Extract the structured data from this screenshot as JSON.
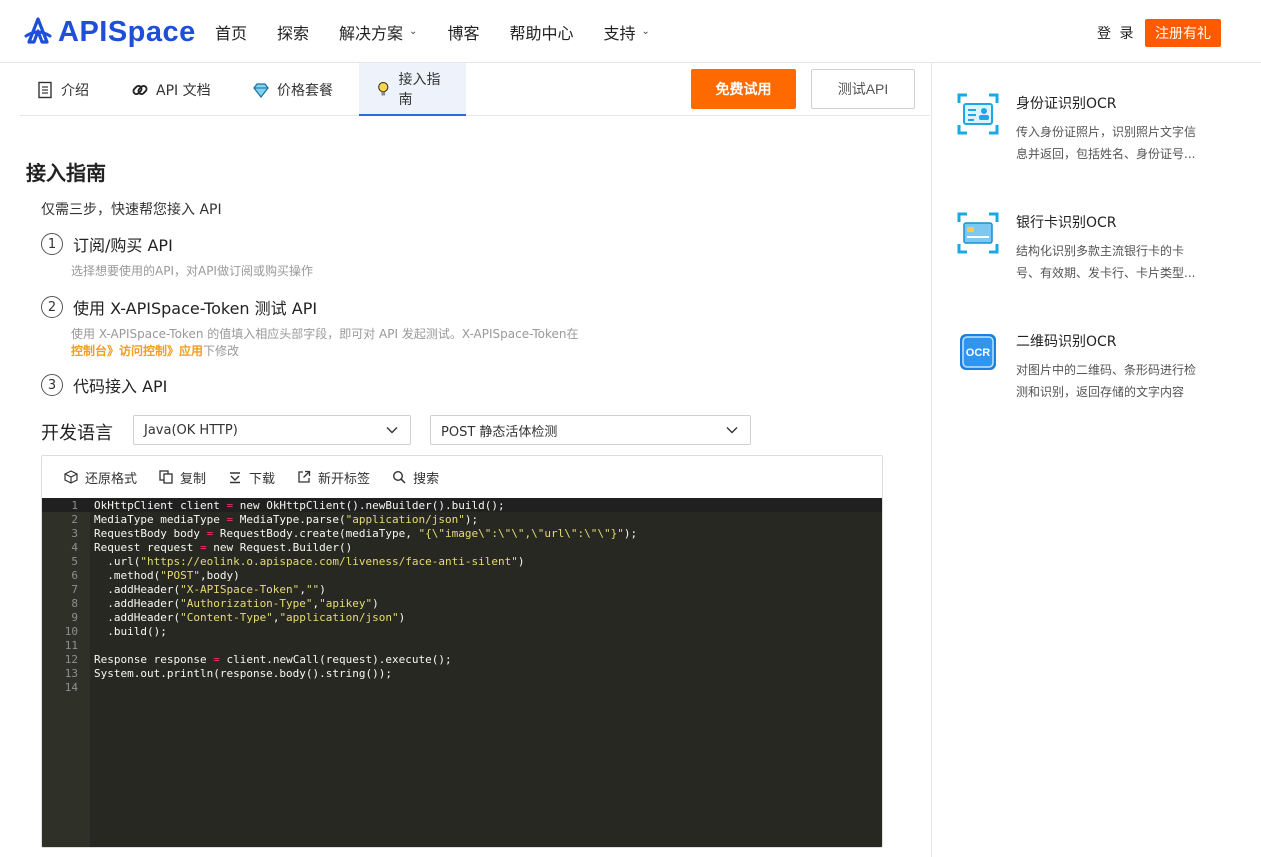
{
  "brand": {
    "name": "APISpace",
    "logo_color": "#1d4fd8"
  },
  "nav": {
    "items": [
      {
        "label": "首页",
        "dropdown": false
      },
      {
        "label": "探索",
        "dropdown": false
      },
      {
        "label": "解决方案",
        "dropdown": true
      },
      {
        "label": "博客",
        "dropdown": false
      },
      {
        "label": "帮助中心",
        "dropdown": false
      },
      {
        "label": "支持",
        "dropdown": true
      }
    ],
    "login_label": "登 录",
    "register_label": "注册有礼"
  },
  "tabs": [
    {
      "label": "介绍",
      "icon": "document-icon"
    },
    {
      "label": "API 文档",
      "icon": "link-icon"
    },
    {
      "label": "价格套餐",
      "icon": "diamond-icon"
    },
    {
      "label": "接入指南",
      "icon": "lightbulb-icon",
      "active": true
    }
  ],
  "actions": {
    "trial_label": "免费试用",
    "test_label": "测试API"
  },
  "guide": {
    "title": "接入指南",
    "intro": "仅需三步，快速帮您接入 API",
    "steps": [
      {
        "num": "1",
        "title": "订阅/购买 API",
        "desc": "选择想要使用的API，对API做订阅或购买操作"
      },
      {
        "num": "2",
        "title": "使用 X-APISpace-Token 测试 API",
        "desc": "使用 X-APISpace-Token 的值填入相应头部字段，即可对 API 发起测试。X-APISpace-Token在",
        "desc_link": "控制台》访问控制》应用",
        "desc_tail": "下修改"
      },
      {
        "num": "3",
        "title": "代码接入 API"
      }
    ]
  },
  "dev": {
    "label": "开发语言",
    "language_selected": "Java(OK HTTP)",
    "endpoint_selected": "POST 静态活体检测"
  },
  "code_toolbar": [
    {
      "label": "还原格式",
      "icon": "cube-icon"
    },
    {
      "label": "复制",
      "icon": "copy-icon"
    },
    {
      "label": "下载",
      "icon": "download-icon"
    },
    {
      "label": "新开标签",
      "icon": "external-link-icon"
    },
    {
      "label": "搜索",
      "icon": "search-icon"
    }
  ],
  "code_lines": [
    "OkHttpClient client = new OkHttpClient().newBuilder().build();",
    "MediaType mediaType = MediaType.parse(\"application/json\");",
    "RequestBody body = RequestBody.create(mediaType, \"{\\\"image\\\":\\\"\\\",\\\"url\\\":\\\"\\\"}\");",
    "Request request = new Request.Builder()",
    "  .url(\"https://eolink.o.apispace.com/liveness/face-anti-silent\")",
    "  .method(\"POST\",body)",
    "  .addHeader(\"X-APISpace-Token\",\"\")",
    "  .addHeader(\"Authorization-Type\",\"apikey\")",
    "  .addHeader(\"Content-Type\",\"application/json\")",
    "  .build();",
    "",
    "Response response = client.newCall(request).execute();",
    "System.out.println(response.body().string());",
    ""
  ],
  "related": [
    {
      "name": "身份证识别OCR",
      "desc": "传入身份证照片，识别照片文字信息并返回，包括姓名、身份证号...",
      "icon": "id-card-icon"
    },
    {
      "name": "银行卡识别OCR",
      "desc": "结构化识别多款主流银行卡的卡号、有效期、发卡行、卡片类型...",
      "icon": "bank-card-icon"
    },
    {
      "name": "二维码识别OCR",
      "desc": "对图片中的二维码、条形码进行检测和识别，返回存储的文字内容",
      "icon": "qr-ocr-icon",
      "badge": "OCR"
    }
  ],
  "colors": {
    "accent_orange": "#ff6a00",
    "register_orange": "#ff5a00",
    "link_blue": "#2f6ad8",
    "highlight": "#f0a020",
    "icon_cyan": "#1aa9e6"
  }
}
